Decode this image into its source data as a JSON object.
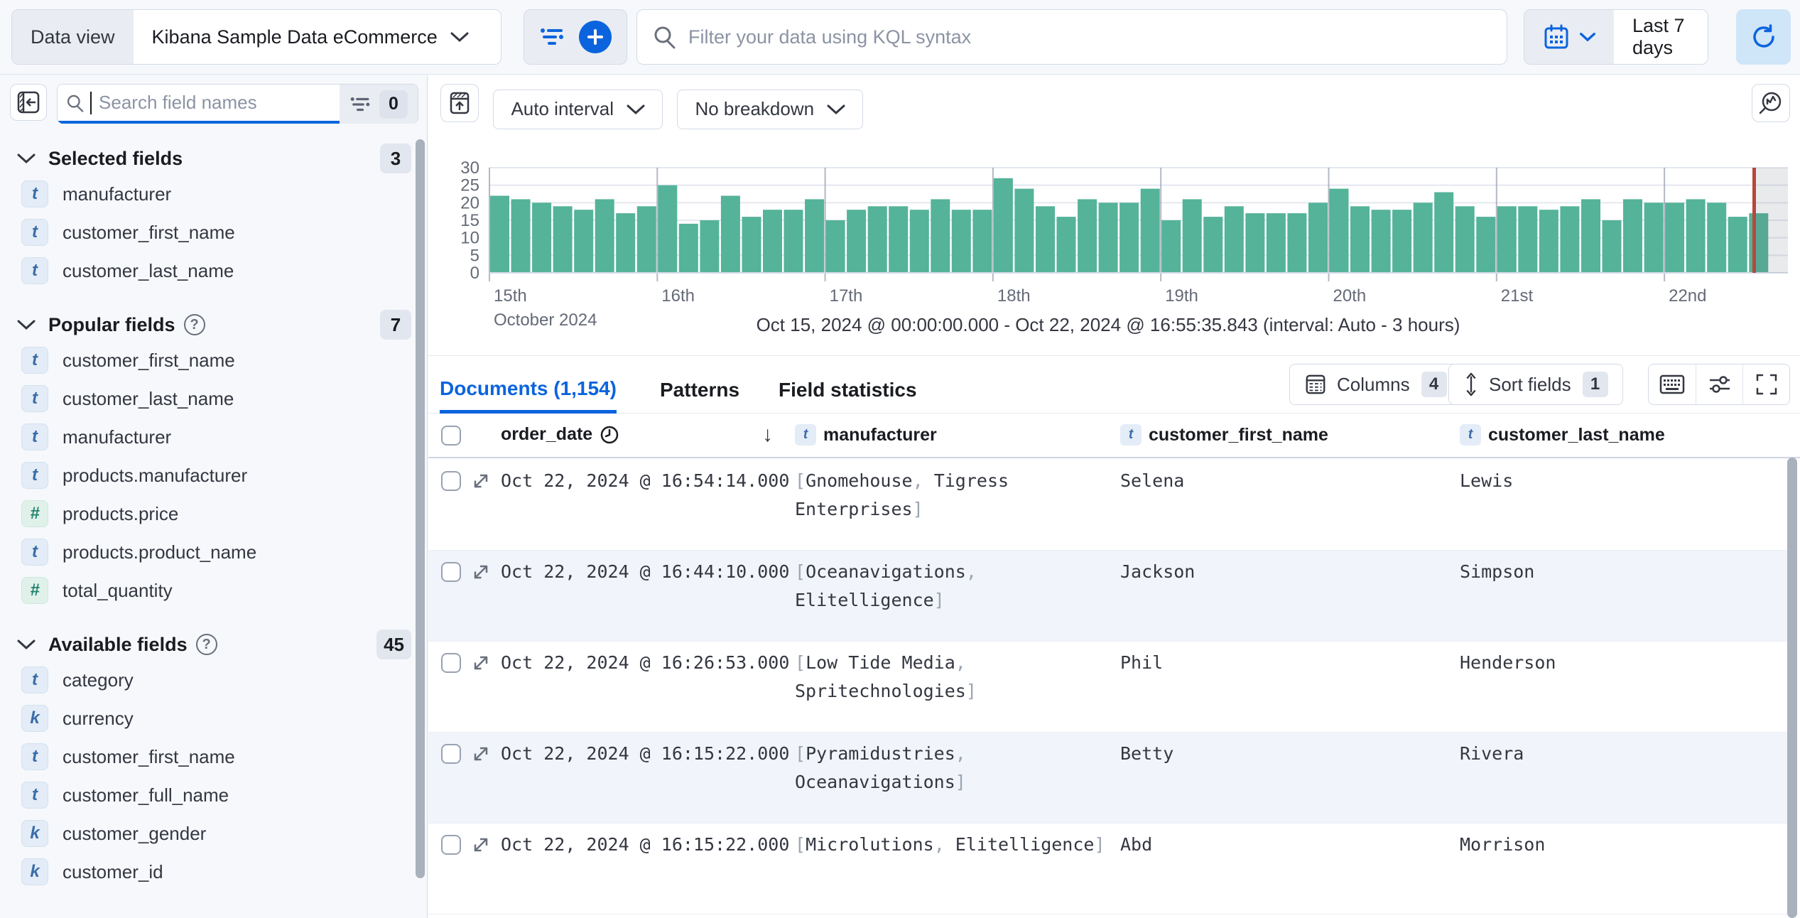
{
  "topbar": {
    "data_view_label": "Data view",
    "data_view_value": "Kibana Sample Data eCommerce",
    "kql_placeholder": "Filter your data using KQL syntax",
    "time_range": "Last 7 days"
  },
  "sidebar": {
    "search_placeholder": "Search field names",
    "filter_count": "0",
    "sections": [
      {
        "title": "Selected fields",
        "badge": "3",
        "help": false,
        "fields": [
          {
            "type": "t",
            "name": "manufacturer"
          },
          {
            "type": "t",
            "name": "customer_first_name"
          },
          {
            "type": "t",
            "name": "customer_last_name"
          }
        ]
      },
      {
        "title": "Popular fields",
        "badge": "7",
        "help": true,
        "fields": [
          {
            "type": "t",
            "name": "customer_first_name"
          },
          {
            "type": "t",
            "name": "customer_last_name"
          },
          {
            "type": "t",
            "name": "manufacturer"
          },
          {
            "type": "t",
            "name": "products.manufacturer"
          },
          {
            "type": "#",
            "name": "products.price"
          },
          {
            "type": "t",
            "name": "products.product_name"
          },
          {
            "type": "#",
            "name": "total_quantity"
          }
        ]
      },
      {
        "title": "Available fields",
        "badge": "45",
        "help": true,
        "fields": [
          {
            "type": "t",
            "name": "category"
          },
          {
            "type": "k",
            "name": "currency"
          },
          {
            "type": "t",
            "name": "customer_first_name"
          },
          {
            "type": "t",
            "name": "customer_full_name"
          },
          {
            "type": "k",
            "name": "customer_gender"
          },
          {
            "type": "k",
            "name": "customer_id"
          }
        ]
      }
    ]
  },
  "chart": {
    "controls": {
      "interval_label": "Auto interval",
      "breakdown_label": "No breakdown"
    },
    "subtitle": "Oct 15, 2024 @ 00:00:00.000 - Oct 22, 2024 @ 16:55:35.843 (interval: Auto - 3 hours)"
  },
  "chart_data": {
    "type": "bar",
    "title": "",
    "xlabel": "October 2024",
    "ylabel": "",
    "ylim": [
      0,
      30
    ],
    "y_ticks": [
      0,
      5,
      10,
      15,
      20,
      25,
      30
    ],
    "x_ticks": [
      "15th",
      "16th",
      "17th",
      "18th",
      "19th",
      "20th",
      "21st",
      "22nd"
    ],
    "x_subtitle": "October 2024",
    "interval": "3 hours",
    "bar_color": "#54b399",
    "time_marker_color": "#b9473b",
    "values": [
      22,
      21,
      20,
      19,
      18,
      21,
      17,
      19,
      25,
      14,
      15,
      22,
      16,
      18,
      18,
      21,
      15,
      18,
      19,
      19,
      18,
      21,
      18,
      18,
      27,
      24,
      19,
      16,
      21,
      20,
      20,
      24,
      15,
      21,
      16,
      19,
      17,
      17,
      17,
      20,
      24,
      19,
      18,
      18,
      20,
      23,
      19,
      16,
      19,
      19,
      18,
      19,
      21,
      15,
      21,
      20,
      20,
      21,
      20,
      16,
      17
    ]
  },
  "tabs": [
    {
      "label": "Documents (1,154)",
      "active": true
    },
    {
      "label": "Patterns",
      "active": false
    },
    {
      "label": "Field statistics",
      "active": false
    }
  ],
  "toolbar": {
    "columns_label": "Columns",
    "columns_count": "4",
    "sort_label": "Sort fields",
    "sort_count": "1"
  },
  "table": {
    "headers": [
      {
        "label": "order_date",
        "token": "",
        "has_clock": true,
        "sort": "desc"
      },
      {
        "label": "manufacturer",
        "token": "t"
      },
      {
        "label": "customer_first_name",
        "token": "t"
      },
      {
        "label": "customer_last_name",
        "token": "t"
      }
    ],
    "rows": [
      {
        "order_date": "Oct 22, 2024 @ 16:54:14.000",
        "manufacturer": [
          "Gnomehouse",
          "Tigress Enterprises"
        ],
        "customer_first_name": "Selena",
        "customer_last_name": "Lewis"
      },
      {
        "order_date": "Oct 22, 2024 @ 16:44:10.000",
        "manufacturer": [
          "Oceanavigations",
          "Elitelligence"
        ],
        "customer_first_name": "Jackson",
        "customer_last_name": "Simpson"
      },
      {
        "order_date": "Oct 22, 2024 @ 16:26:53.000",
        "manufacturer": [
          "Low Tide Media",
          "Spritechnologies"
        ],
        "customer_first_name": "Phil",
        "customer_last_name": "Henderson"
      },
      {
        "order_date": "Oct 22, 2024 @ 16:15:22.000",
        "manufacturer": [
          "Pyramidustries",
          "Oceanavigations"
        ],
        "customer_first_name": "Betty",
        "customer_last_name": "Rivera"
      },
      {
        "order_date": "Oct 22, 2024 @ 16:15:22.000",
        "manufacturer": [
          "Microlutions",
          "Elitelligence"
        ],
        "customer_first_name": "Abd",
        "customer_last_name": "Morrison"
      }
    ]
  }
}
